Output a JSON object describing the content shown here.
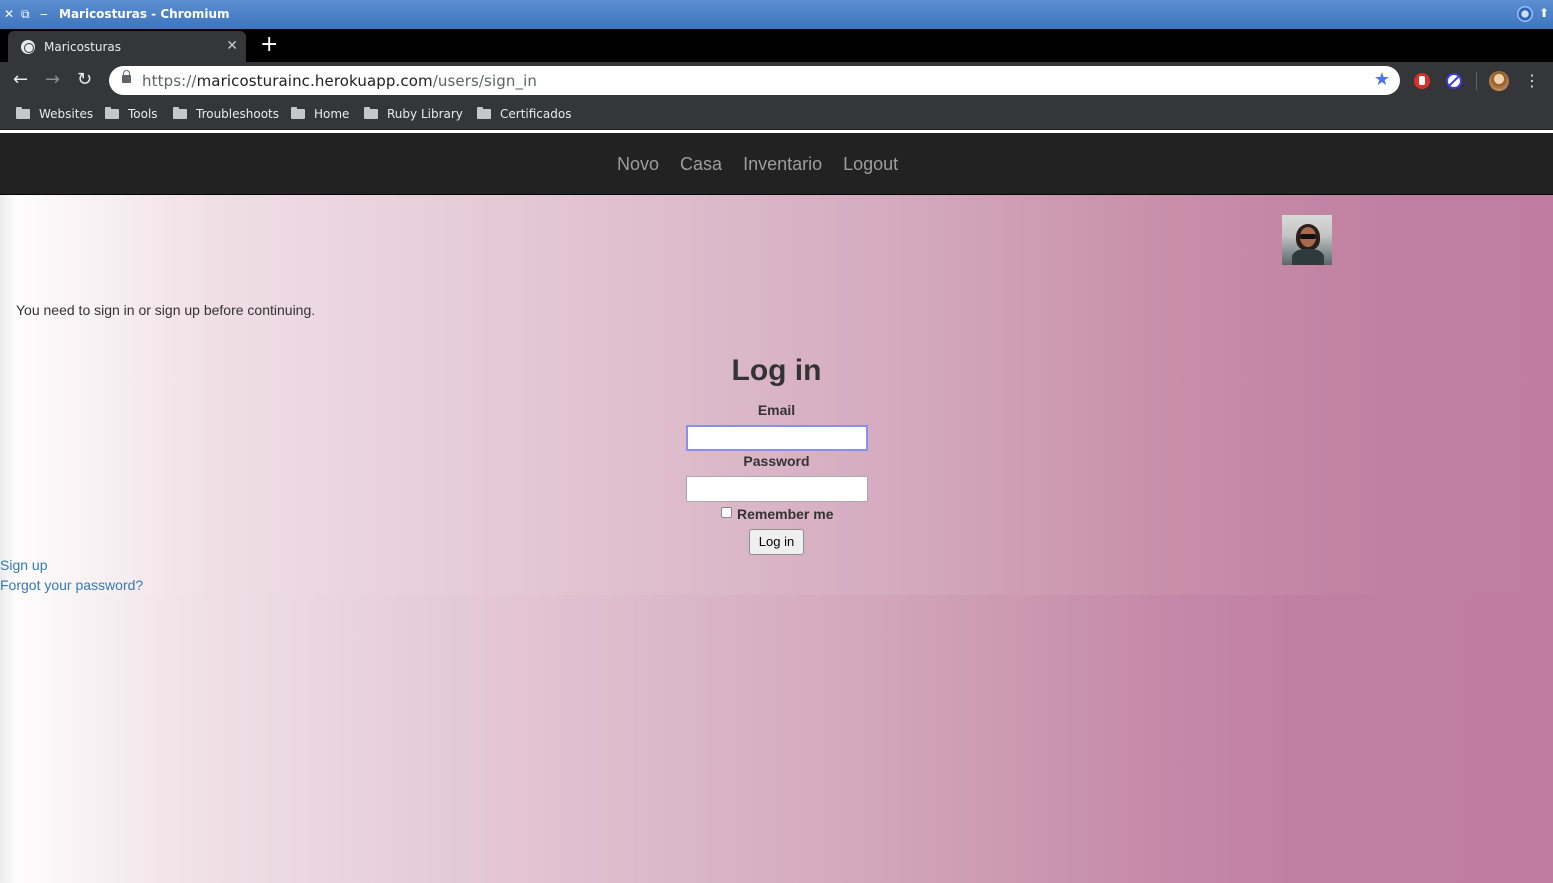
{
  "window": {
    "title": "Maricosturas - Chromium",
    "controls": [
      "✕",
      "⧉",
      "‒"
    ]
  },
  "tab": {
    "title": "Maricosturas",
    "close": "✕",
    "new_tab": "+"
  },
  "toolbar": {
    "back": "←",
    "forward": "→",
    "reload": "↻",
    "url_scheme": "https://",
    "url_host": "maricosturainc.herokuapp.com",
    "url_path": "/users/sign_in",
    "star": "★",
    "menu": "⋮"
  },
  "bookmarks": [
    {
      "label": "Websites"
    },
    {
      "label": "Tools"
    },
    {
      "label": "Troubleshoots"
    },
    {
      "label": "Home"
    },
    {
      "label": "Ruby Library"
    },
    {
      "label": "Certificados"
    }
  ],
  "navbar": {
    "links": [
      "Novo",
      "Casa",
      "Inventario",
      "Logout"
    ]
  },
  "alert": "You need to sign in or sign up before continuing.",
  "login": {
    "title": "Log in",
    "email_label": "Email",
    "email_value": "",
    "password_label": "Password",
    "password_value": "",
    "remember_label": "Remember me",
    "remember_checked": false,
    "submit_label": "Log in"
  },
  "links": {
    "sign_up": "Sign up",
    "forgot_password": "Forgot your password?"
  },
  "colors": {
    "navbar_bg": "#222222",
    "nav_link": "#9d9d9d",
    "link": "#337ab7",
    "bg_gradient_end": "#c07da0"
  }
}
